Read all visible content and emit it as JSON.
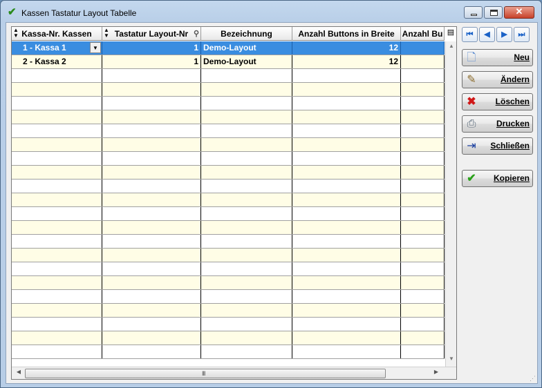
{
  "window": {
    "title": "Kassen Tastatur Layout Tabelle",
    "title_icon": "green-check-icon"
  },
  "grid": {
    "columns": [
      "Kassa-Nr. Kassen",
      "Tastatur Layout-Nr",
      "Bezeichnung",
      "Anzahl Buttons in Breite",
      "Anzahl Bu"
    ],
    "rows": [
      {
        "kassa": "1 - Kassa 1",
        "layout_nr": "1",
        "bezeichnung": "Demo-Layout",
        "buttons_breite": "12",
        "buttons_hoehe": ""
      },
      {
        "kassa": "2 - Kassa 2",
        "layout_nr": "1",
        "bezeichnung": "Demo-Layout",
        "buttons_breite": "12",
        "buttons_hoehe": ""
      }
    ],
    "empty_rows": 21,
    "selected_row": 0,
    "colors": {
      "selected": "#3a8de0",
      "row_alt": "#fffde6"
    }
  },
  "nav": {
    "first": "⏮",
    "prev": "◀",
    "next": "▶",
    "last": "⏭"
  },
  "actions": {
    "new": "Neu",
    "edit": "Ändern",
    "delete": "Löschen",
    "print": "Drucken",
    "close": "Schließen",
    "copy": "Kopieren"
  },
  "scroll": {
    "grip": "III"
  }
}
